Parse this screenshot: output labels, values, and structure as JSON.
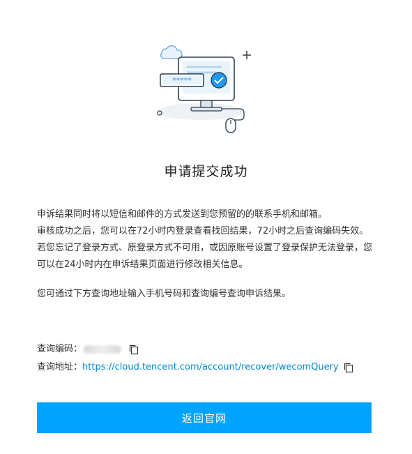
{
  "page": {
    "title": "申请提交成功",
    "description": [
      "申诉结果同时将以短信和邮件的方式发送到您预留的的联系手机和邮箱。",
      "审核成功之后，您可以在72小时内登录查看找回结果，72小时之后查询编码失效。",
      "若您忘记了登录方式、原登录方式不可用，或因原账号设置了登录保护无法登录，您可以在24小时内在申诉结果页面进行修改相关信息。",
      "您可通过下方查询地址输入手机号码和查询编号查询申诉结果。"
    ],
    "query_code_label": "查询编码：",
    "query_code_value": "",
    "query_url_label": "查询地址：",
    "query_url": "https://cloud.tencent.com/account/recover/wecomQuery",
    "back_button_label": "返回官网",
    "illustration_password": "*****"
  },
  "colors": {
    "accent": "#00a4ff",
    "link": "#0086d1",
    "success_check": "#1e9bf0"
  },
  "icons": [
    "cloud-icon",
    "plus-icon",
    "computer-monitor-icon",
    "checkmark-icon",
    "mouse-icon",
    "copy-icon"
  ]
}
